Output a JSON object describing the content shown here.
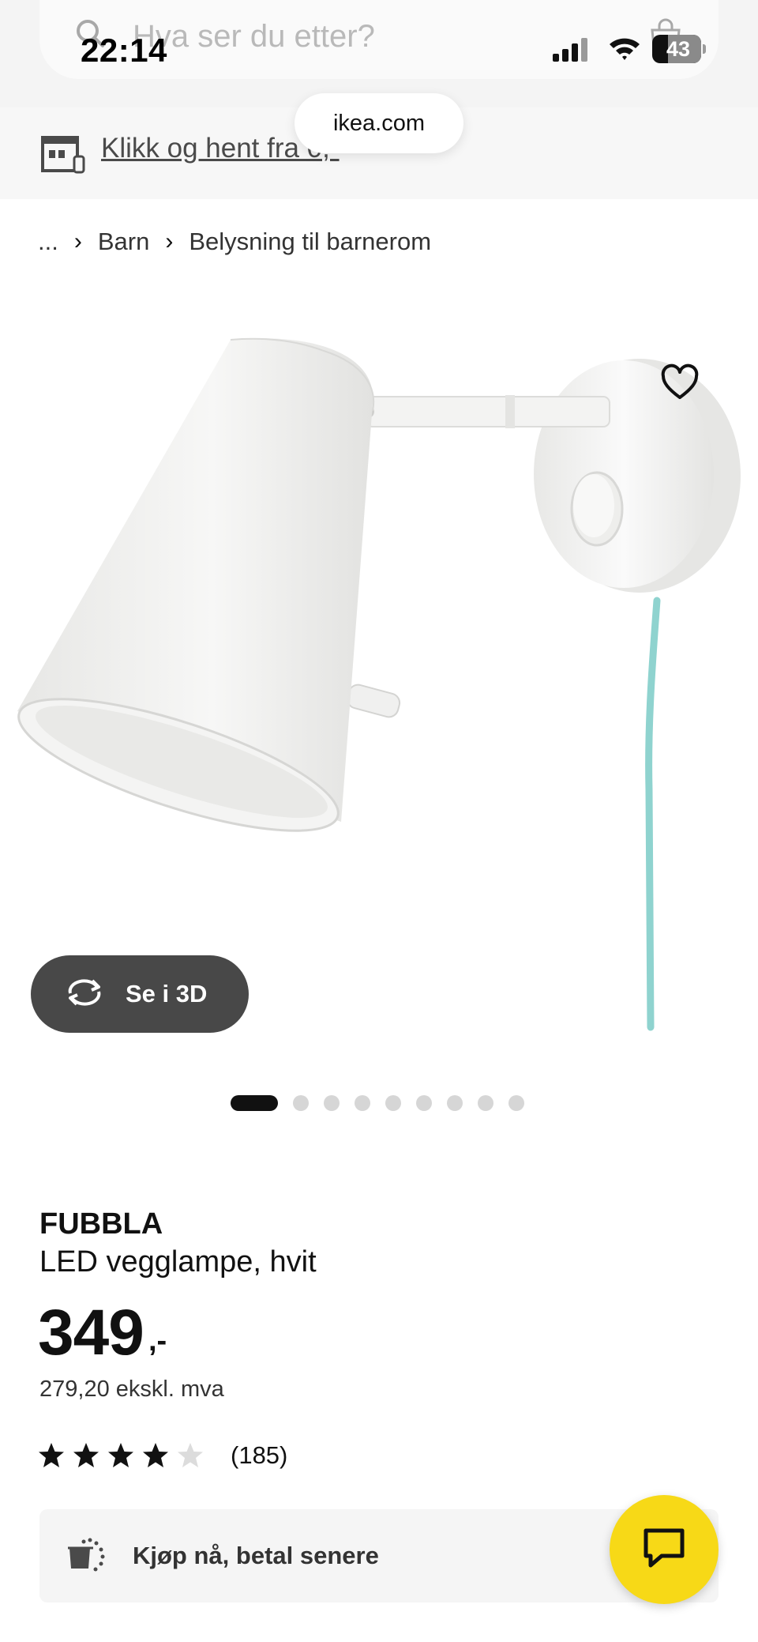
{
  "status_bar": {
    "time": "22:14",
    "battery": "43"
  },
  "header": {
    "search_placeholder": "Hva ser du etter?",
    "store_link": "Klikk og hent fra 0,-",
    "url": "ikea.com"
  },
  "breadcrumb": {
    "items": [
      "...",
      "Barn",
      "Belysning til barnerom"
    ]
  },
  "gallery": {
    "view_3d_label": "Se i 3D",
    "image_count": 9,
    "active_index": 0
  },
  "product": {
    "name": "FUBBLA",
    "description": "LED vegglampe, hvit",
    "price": "349",
    "price_suffix": ",-",
    "price_ex_vat": "279,20 ekskl. mva",
    "rating": 4,
    "rating_max": 5,
    "review_count": "(185)"
  },
  "bnpl": {
    "label": "Kjøp nå, betal senere"
  },
  "colors": {
    "accent_yellow": "#f7d917",
    "dark_button": "#484848",
    "cord": "#8fd3cf"
  }
}
